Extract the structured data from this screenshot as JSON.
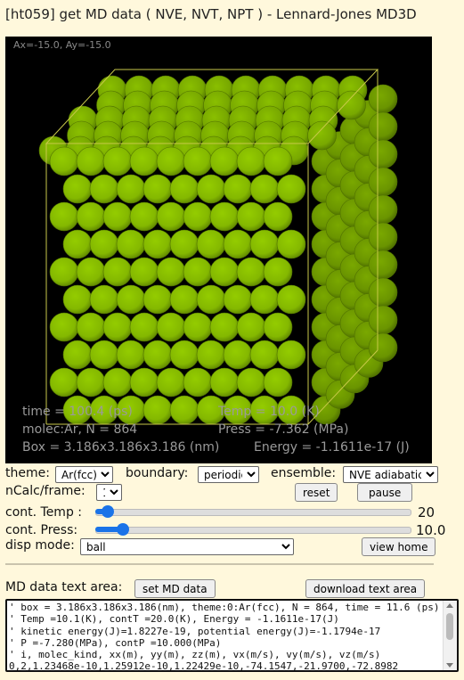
{
  "title": "[ht059] get MD data ( NVE, NVT, NPT ) - Lennard-Jones MD3D",
  "viewport": {
    "angle_readout": "Ax=-15.0, Ay=-15.0",
    "stats": {
      "time": "time = 100.4 (ps)",
      "temp": "Temp = 10.0 (K)",
      "molec": "molec:Ar, N = 864",
      "press": "Press = -7.362 (MPa)",
      "box": "Box = 3.186x3.186x3.186 (nm)",
      "energy": "Energy = -1.1611e-17 (J)"
    },
    "colors": {
      "background": "#000000",
      "atom": "#88c000",
      "edge": "#c8c84a"
    }
  },
  "controls": {
    "theme_label": "theme:",
    "theme_value": "Ar(fcc)",
    "boundary_label": "boundary:",
    "boundary_value": "periodic",
    "ensemble_label": "ensemble:",
    "ensemble_value": "NVE adiabatic",
    "ncalc_label": "nCalc/frame:",
    "ncalc_value": "1",
    "reset_label": "reset",
    "pause_label": "pause",
    "cont_temp_label": "cont. Temp :",
    "cont_temp_value": "20",
    "cont_temp_level": 0.02,
    "cont_press_label": "cont. Press:",
    "cont_press_value": "10.0",
    "cont_press_level": 0.07,
    "disp_mode_label": "disp mode:",
    "disp_mode_value": "ball",
    "view_home_label": "view home"
  },
  "md_data": {
    "label": "MD data text area:",
    "set_button": "set MD data",
    "download_button": "download text area",
    "lines": [
      "' box = 3.186x3.186x3.186(nm), theme:0:Ar(fcc), N = 864, time = 11.6 (ps)",
      "' Temp =10.1(K), contT =20.0(K), Energy = -1.1611e-17(J)",
      "' kinetic energy(J)=1.8227e-19, potential energy(J)=-1.1794e-17",
      "' P =-7.280(MPa), contP =10.000(MPa)",
      "' i, molec_kind, xx(m), yy(m), zz(m), vx(m/s), vy(m/s), vz(m/s)",
      "0,2,1.23468e-10,1.25912e-10,1.22429e-10,-74.1547,-21.9700,-72.8982"
    ]
  }
}
